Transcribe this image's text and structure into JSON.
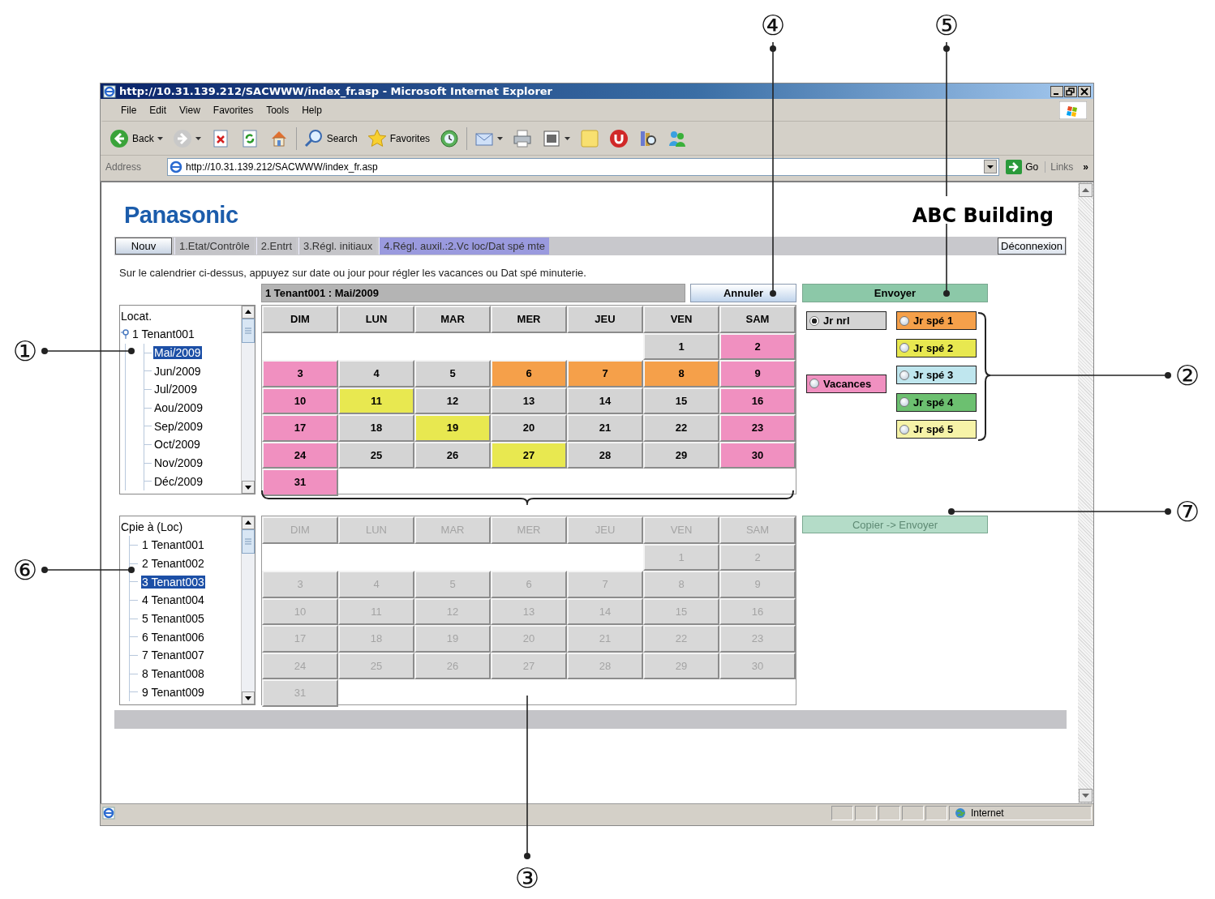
{
  "browser": {
    "title": "http://10.31.139.212/SACWWW/index_fr.asp - Microsoft Internet Explorer",
    "menu": [
      "File",
      "Edit",
      "View",
      "Favorites",
      "Tools",
      "Help"
    ],
    "toolbar": [
      {
        "kind": "back",
        "label": "Back",
        "dropdown": true
      },
      {
        "kind": "forward",
        "dropdown": true
      },
      {
        "kind": "stop",
        "dropdown": false
      },
      {
        "kind": "refresh",
        "dropdown": false
      },
      {
        "kind": "home",
        "dropdown": false
      },
      {
        "kind": "search",
        "label": "Search",
        "dropdown": false
      },
      {
        "kind": "favorites",
        "label": "Favorites",
        "dropdown": false
      },
      {
        "kind": "history",
        "dropdown": false
      },
      {
        "kind": "mail",
        "dropdown": true
      },
      {
        "kind": "print",
        "dropdown": false
      },
      {
        "kind": "edit",
        "dropdown": true
      },
      {
        "kind": "note",
        "dropdown": false
      },
      {
        "kind": "power",
        "dropdown": false
      },
      {
        "kind": "research",
        "dropdown": false
      },
      {
        "kind": "messenger",
        "dropdown": false
      }
    ],
    "address_label": "Address",
    "url": "http://10.31.139.212/SACWWW/index_fr.asp",
    "go": "Go",
    "links": "Links",
    "links_more": "»",
    "status": "Internet"
  },
  "page": {
    "logo": "Panasonic",
    "building": "ABC Building",
    "new_button": "Nouv",
    "tabs": [
      {
        "label": "1.Etat/Contrôle",
        "selected": false
      },
      {
        "label": "2.Entrt",
        "selected": false
      },
      {
        "label": "3.Régl. initiaux",
        "selected": false
      },
      {
        "label": "4.Régl. auxil.:2.Vc loc/Dat spé mte",
        "selected": true
      }
    ],
    "logout": "Déconnexion",
    "instruction": "Sur le calendrier ci-dessus, appuyez sur date ou jour pour régler les vacances ou Dat spé minuterie.",
    "calendar_title": "1 Tenant001 : Mai/2009",
    "cancel": "Annuler",
    "send": "Envoyer",
    "location_tree": {
      "title": "Locat.",
      "nodes": [
        {
          "label": "1 Tenant001",
          "expanded": true,
          "selected": false,
          "children": [
            {
              "label": "Mai/2009",
              "selected": true
            },
            {
              "label": "Jun/2009",
              "selected": false
            },
            {
              "label": "Jul/2009",
              "selected": false
            },
            {
              "label": "Aou/2009",
              "selected": false
            },
            {
              "label": "Sep/2009",
              "selected": false
            },
            {
              "label": "Oct/2009",
              "selected": false
            },
            {
              "label": "Nov/2009",
              "selected": false
            },
            {
              "label": "Déc/2009",
              "selected": false
            }
          ]
        }
      ]
    },
    "calendar": {
      "disabled": false,
      "weekdays": [
        "DIM",
        "LUN",
        "MAR",
        "MER",
        "JEU",
        "VEN",
        "SAM"
      ],
      "weeks": [
        {
          "kind": "leading",
          "days": [
            {
              "label": "1",
              "color": "#d4d4d4"
            },
            {
              "label": "2",
              "color": "#f090c0"
            }
          ]
        },
        {
          "kind": "full",
          "days": [
            {
              "label": "3",
              "color": "#f090c0"
            },
            {
              "label": "4",
              "color": "#d4d4d4"
            },
            {
              "label": "5",
              "color": "#d4d4d4"
            },
            {
              "label": "6",
              "color": "#f5a04a"
            },
            {
              "label": "7",
              "color": "#f5a04a"
            },
            {
              "label": "8",
              "color": "#f5a04a"
            },
            {
              "label": "9",
              "color": "#f090c0"
            }
          ]
        },
        {
          "kind": "full",
          "days": [
            {
              "label": "10",
              "color": "#f090c0"
            },
            {
              "label": "11",
              "color": "#e8e850"
            },
            {
              "label": "12",
              "color": "#d4d4d4"
            },
            {
              "label": "13",
              "color": "#d4d4d4"
            },
            {
              "label": "14",
              "color": "#d4d4d4"
            },
            {
              "label": "15",
              "color": "#d4d4d4"
            },
            {
              "label": "16",
              "color": "#f090c0"
            }
          ]
        },
        {
          "kind": "full",
          "days": [
            {
              "label": "17",
              "color": "#f090c0"
            },
            {
              "label": "18",
              "color": "#d4d4d4"
            },
            {
              "label": "19",
              "color": "#e8e850"
            },
            {
              "label": "20",
              "color": "#d4d4d4"
            },
            {
              "label": "21",
              "color": "#d4d4d4"
            },
            {
              "label": "22",
              "color": "#d4d4d4"
            },
            {
              "label": "23",
              "color": "#f090c0"
            }
          ]
        },
        {
          "kind": "full",
          "days": [
            {
              "label": "24",
              "color": "#f090c0"
            },
            {
              "label": "25",
              "color": "#d4d4d4"
            },
            {
              "label": "26",
              "color": "#d4d4d4"
            },
            {
              "label": "27",
              "color": "#e8e850"
            },
            {
              "label": "28",
              "color": "#d4d4d4"
            },
            {
              "label": "29",
              "color": "#d4d4d4"
            },
            {
              "label": "30",
              "color": "#f090c0"
            }
          ]
        },
        {
          "kind": "trailing",
          "days": [
            {
              "label": "31",
              "color": "#f090c0"
            }
          ]
        }
      ]
    },
    "day_types": [
      {
        "label": "Jr nrl",
        "color": "#d4d4d4",
        "selected": true,
        "kind": "basic"
      },
      {
        "label": "Vacances",
        "color": "#f090c0",
        "selected": false,
        "kind": "basic"
      },
      {
        "label": "Jr spé 1",
        "color": "#f5a04a",
        "selected": false,
        "kind": "special"
      },
      {
        "label": "Jr spé 2",
        "color": "#e8e850",
        "selected": false,
        "kind": "special"
      },
      {
        "label": "Jr spé 3",
        "color": "#bfe6ee",
        "selected": false,
        "kind": "special"
      },
      {
        "label": "Jr spé 4",
        "color": "#6cc070",
        "selected": false,
        "kind": "special"
      },
      {
        "label": "Jr spé 5",
        "color": "#f6f3a8",
        "selected": false,
        "kind": "special"
      }
    ],
    "copy_tree": {
      "title": "Cpie à (Loc)",
      "nodes": [
        {
          "label": "1 Tenant001",
          "selected": false
        },
        {
          "label": "2 Tenant002",
          "selected": false
        },
        {
          "label": "3 Tenant003",
          "selected": true
        },
        {
          "label": "4 Tenant004",
          "selected": false
        },
        {
          "label": "5 Tenant005",
          "selected": false
        },
        {
          "label": "6 Tenant006",
          "selected": false
        },
        {
          "label": "7 Tenant007",
          "selected": false
        },
        {
          "label": "8 Tenant008",
          "selected": false
        },
        {
          "label": "9 Tenant009",
          "selected": false
        }
      ]
    },
    "copy_calendar": {
      "disabled": true,
      "weekdays": [
        "DIM",
        "LUN",
        "MAR",
        "MER",
        "JEU",
        "VEN",
        "SAM"
      ],
      "weeks": [
        {
          "kind": "leading",
          "days": [
            {
              "label": "1"
            },
            {
              "label": "2"
            }
          ]
        },
        {
          "kind": "full",
          "days": [
            {
              "label": "3"
            },
            {
              "label": "4"
            },
            {
              "label": "5"
            },
            {
              "label": "6"
            },
            {
              "label": "7"
            },
            {
              "label": "8"
            },
            {
              "label": "9"
            }
          ]
        },
        {
          "kind": "full",
          "days": [
            {
              "label": "10"
            },
            {
              "label": "11"
            },
            {
              "label": "12"
            },
            {
              "label": "13"
            },
            {
              "label": "14"
            },
            {
              "label": "15"
            },
            {
              "label": "16"
            }
          ]
        },
        {
          "kind": "full",
          "days": [
            {
              "label": "17"
            },
            {
              "label": "18"
            },
            {
              "label": "19"
            },
            {
              "label": "20"
            },
            {
              "label": "21"
            },
            {
              "label": "22"
            },
            {
              "label": "23"
            }
          ]
        },
        {
          "kind": "full",
          "days": [
            {
              "label": "24"
            },
            {
              "label": "25"
            },
            {
              "label": "26"
            },
            {
              "label": "27"
            },
            {
              "label": "28"
            },
            {
              "label": "29"
            },
            {
              "label": "30"
            }
          ]
        },
        {
          "kind": "trailing",
          "days": [
            {
              "label": "31"
            }
          ]
        }
      ]
    },
    "copy_send": {
      "label": "Copier -> Envoyer",
      "disabled": true
    }
  },
  "callouts": [
    {
      "label": "①"
    },
    {
      "label": "②"
    },
    {
      "label": "③"
    },
    {
      "label": "④"
    },
    {
      "label": "⑤"
    },
    {
      "label": "⑥"
    },
    {
      "label": "⑦"
    }
  ]
}
